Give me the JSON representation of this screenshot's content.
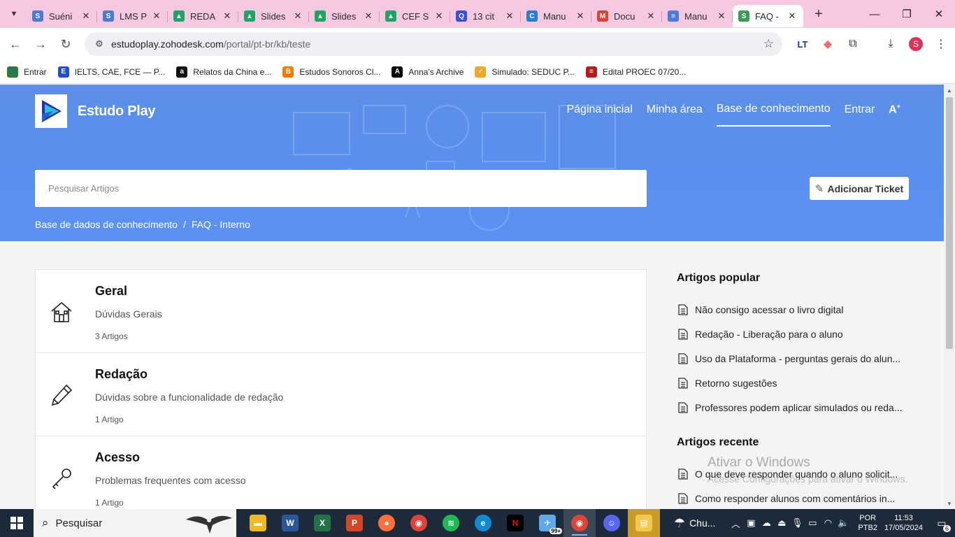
{
  "browser": {
    "tabs": [
      {
        "title": "Suéni",
        "fav_color": "#4a7bd8",
        "fav_glyph": "S"
      },
      {
        "title": "LMS P",
        "fav_color": "#4a7bd8",
        "fav_glyph": "S"
      },
      {
        "title": "REDA",
        "fav_color": "#1fa463",
        "fav_glyph": "▲"
      },
      {
        "title": "Slides",
        "fav_color": "#1fa463",
        "fav_glyph": "▲"
      },
      {
        "title": "Slides",
        "fav_color": "#1fa463",
        "fav_glyph": "▲"
      },
      {
        "title": "CEF S",
        "fav_color": "#1fa463",
        "fav_glyph": "▲"
      },
      {
        "title": "13 cit",
        "fav_color": "#3b4ee0",
        "fav_glyph": "Q"
      },
      {
        "title": "Manu",
        "fav_color": "#2a7ad8",
        "fav_glyph": "C"
      },
      {
        "title": "Docu",
        "fav_color": "#d94435",
        "fav_glyph": "M"
      },
      {
        "title": "Manu",
        "fav_color": "#4a7bd8",
        "fav_glyph": "≡"
      },
      {
        "title": "FAQ -",
        "fav_color": "#3a9d56",
        "fav_glyph": "S"
      }
    ],
    "address": {
      "host": "estudoplay.zohodesk.com",
      "path": "/portal/pt-br/kb/teste"
    },
    "profile_initial": "S",
    "bookmarks": [
      {
        "label": "Entrar",
        "color": "#2e7d32",
        "glyph": "🐾"
      },
      {
        "label": "IELTS, CAE, FCE — P...",
        "color": "#2050d0",
        "glyph": "E"
      },
      {
        "label": "Relatos da China e...",
        "color": "#111111",
        "glyph": "a"
      },
      {
        "label": "Estudos Sonoros Cl...",
        "color": "#f57c00",
        "glyph": "B"
      },
      {
        "label": "Anna's Archive",
        "color": "#000000",
        "glyph": "A"
      },
      {
        "label": "Simulado: SEDUC P...",
        "color": "#f5a623",
        "glyph": "✓"
      },
      {
        "label": "Edital PROEC 07/20...",
        "color": "#b71c1c",
        "glyph": "≡"
      }
    ]
  },
  "portal": {
    "brand": "Estudo Play",
    "nav": [
      "Página inicial",
      "Minha área",
      "Base de conhecimento",
      "Entrar"
    ],
    "font_toggle": "A",
    "search_placeholder": "Pesquisar Artigos",
    "ticket_button": "Adicionar Ticket",
    "breadcrumb": [
      "Base de dados de conhecimento",
      "FAQ - Interno"
    ],
    "breadcrumb_sep": "/",
    "categories": [
      {
        "title": "Geral",
        "desc": "Dúvidas Gerais",
        "count": "3 Artigos",
        "icon": "home-icon"
      },
      {
        "title": "Redação",
        "desc": "Dúvidas sobre a funcionalidade de redação",
        "count": "1 Artigo",
        "icon": "pencil-icon"
      },
      {
        "title": "Acesso",
        "desc": "Problemas frequentes com acesso",
        "count": "1 Artigo",
        "icon": "key-icon"
      }
    ],
    "popular_heading": "Artigos popular",
    "popular": [
      "Não consigo acessar o livro digital",
      "Redação - Liberação para o aluno",
      "Uso da Plataforma - perguntas gerais do alun...",
      "Retorno sugestões",
      "Professores podem aplicar simulados ou reda..."
    ],
    "recent_heading": "Artigos recente",
    "recent": [
      "O que deve responder quando o aluno solicit...",
      "Como responder alunos com comentários in..."
    ],
    "watermark_line1": "Ativar o Windows",
    "watermark_line2": "Acesse Configurações para ativar o Windows."
  },
  "taskbar": {
    "search_label": "Pesquisar",
    "weather": "Chu...",
    "lang": [
      "POR",
      "PTB2"
    ],
    "time": "11:53",
    "date": "17/05/2024",
    "notifications": "6",
    "badge_99": "99+"
  }
}
